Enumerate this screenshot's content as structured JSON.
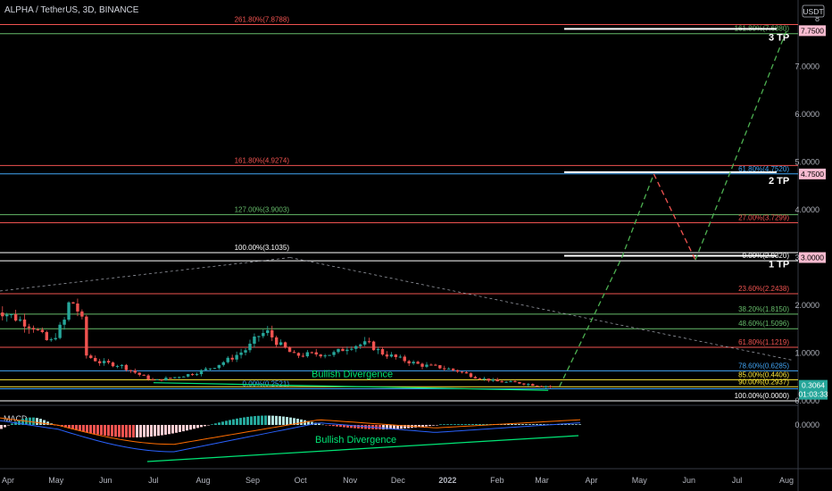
{
  "header": {
    "symbol_title": "ALPHA / TetherUS, 3D, BINANCE",
    "currency": "USDT"
  },
  "colors": {
    "up": "#26a69a",
    "down": "#ef5350",
    "fib_red": "#ef5350",
    "fib_green": "#66bb6a",
    "fib_blue": "#42a5f5",
    "fib_white": "#ffffff",
    "fib_yellow": "#ffeb3b",
    "projection": "#4caf50",
    "projection_down": "#ef5350",
    "divergence": "#00e676",
    "macd_line": "#2962ff",
    "signal_line": "#ff6d00"
  },
  "chart_data": {
    "type": "candlestick",
    "ylim": [
      0,
      8
    ],
    "y_ticks": [
      "0.0000",
      "1.0000",
      "2.0000",
      "3.0000",
      "4.0000",
      "5.0000",
      "6.0000",
      "7.0000",
      "8"
    ],
    "x_ticks": [
      {
        "label": "Apr",
        "date": "2021-04-01"
      },
      {
        "label": "May",
        "date": "2021-05-01"
      },
      {
        "label": "Jun",
        "date": "2021-06-01"
      },
      {
        "label": "Jul",
        "date": "2021-07-01"
      },
      {
        "label": "Aug",
        "date": "2021-08-01"
      },
      {
        "label": "Sep",
        "date": "2021-09-01"
      },
      {
        "label": "Oct",
        "date": "2021-10-01"
      },
      {
        "label": "Nov",
        "date": "2021-11-01"
      },
      {
        "label": "Dec",
        "date": "2021-12-01"
      },
      {
        "label": "2022",
        "date": "2022-01-01"
      },
      {
        "label": "Feb",
        "date": "2022-02-01"
      },
      {
        "label": "Mar",
        "date": "2022-03-01"
      },
      {
        "label": "Apr",
        "date": "2022-04-01"
      },
      {
        "label": "May",
        "date": "2022-05-01"
      },
      {
        "label": "Jun",
        "date": "2022-06-01"
      },
      {
        "label": "Jul",
        "date": "2022-07-01"
      },
      {
        "label": "Aug",
        "date": "2022-08-01"
      }
    ],
    "price_path": [
      {
        "date": "2021-03-23",
        "close": 1.95
      },
      {
        "date": "2021-04-05",
        "close": 1.75
      },
      {
        "date": "2021-04-17",
        "close": 1.55
      },
      {
        "date": "2021-04-27",
        "close": 1.2
      },
      {
        "date": "2021-05-06",
        "close": 1.65
      },
      {
        "date": "2021-05-10",
        "close": 2.15
      },
      {
        "date": "2021-05-17",
        "close": 1.75
      },
      {
        "date": "2021-05-20",
        "close": 0.95
      },
      {
        "date": "2021-05-29",
        "close": 0.8
      },
      {
        "date": "2021-06-10",
        "close": 0.75
      },
      {
        "date": "2021-06-22",
        "close": 0.55
      },
      {
        "date": "2021-07-01",
        "close": 0.42
      },
      {
        "date": "2021-07-15",
        "close": 0.5
      },
      {
        "date": "2021-07-27",
        "close": 0.58
      },
      {
        "date": "2021-08-08",
        "close": 0.72
      },
      {
        "date": "2021-08-19",
        "close": 0.9
      },
      {
        "date": "2021-08-29",
        "close": 1.1
      },
      {
        "date": "2021-09-04",
        "close": 1.35
      },
      {
        "date": "2021-09-10",
        "close": 1.45
      },
      {
        "date": "2021-09-17",
        "close": 1.2
      },
      {
        "date": "2021-09-27",
        "close": 0.95
      },
      {
        "date": "2021-10-09",
        "close": 0.98
      },
      {
        "date": "2021-10-21",
        "close": 0.98
      },
      {
        "date": "2021-11-01",
        "close": 1.15
      },
      {
        "date": "2021-11-12",
        "close": 1.2
      },
      {
        "date": "2021-11-21",
        "close": 1.0
      },
      {
        "date": "2021-12-02",
        "close": 0.88
      },
      {
        "date": "2021-12-15",
        "close": 0.75
      },
      {
        "date": "2021-12-28",
        "close": 0.7
      },
      {
        "date": "2022-01-08",
        "close": 0.62
      },
      {
        "date": "2022-01-20",
        "close": 0.48
      },
      {
        "date": "2022-02-02",
        "close": 0.4
      },
      {
        "date": "2022-02-14",
        "close": 0.38
      },
      {
        "date": "2022-02-27",
        "close": 0.32
      },
      {
        "date": "2022-03-08",
        "close": 0.3
      }
    ],
    "fib_levels_left": [
      {
        "label": "261.80%(7.8788)",
        "value": 7.8788,
        "color": "fib_red"
      },
      {
        "label": "161.80%(4.9274)",
        "value": 4.9274,
        "color": "fib_red"
      },
      {
        "label": "127.00%(3.9003)",
        "value": 3.9003,
        "color": "fib_green"
      },
      {
        "label": "100.00%(3.1035)",
        "value": 3.1035,
        "color": "fib_white"
      },
      {
        "label": "0.00%(0.2521)",
        "value": 0.2521,
        "color": "fib_blue"
      }
    ],
    "fib_levels_right": [
      {
        "label": "161.80%(7.6880)",
        "value": 7.688,
        "color": "fib_green"
      },
      {
        "label": "61.80%(4.7520)",
        "value": 4.752,
        "color": "fib_blue"
      },
      {
        "label": "27.00%(3.7299)",
        "value": 3.7299,
        "color": "fib_red"
      },
      {
        "label": "0.00%(2.9320)",
        "value": 2.932,
        "color": "fib_white"
      },
      {
        "label": "23.60%(2.2438)",
        "value": 2.2438,
        "color": "fib_red"
      },
      {
        "label": "38.20%(1.8150)",
        "value": 1.815,
        "color": "fib_green"
      },
      {
        "label": "48.60%(1.5096)",
        "value": 1.5096,
        "color": "fib_green"
      },
      {
        "label": "61.80%(1.1219)",
        "value": 1.1219,
        "color": "fib_red"
      },
      {
        "label": "78.60%(0.6285)",
        "value": 0.6285,
        "color": "fib_blue"
      },
      {
        "label": "85.00%(0.4406)",
        "value": 0.4406,
        "color": "fib_yellow"
      },
      {
        "label": "90.00%(0.2937)",
        "value": 0.2937,
        "color": "fib_yellow"
      },
      {
        "label": "100.00%(0.0000)",
        "value": 0.0,
        "color": "fib_white"
      }
    ],
    "targets": [
      {
        "label": "3 TP",
        "price": "7.7500",
        "value": 7.75
      },
      {
        "label": "2 TP",
        "price": "4.7500",
        "value": 4.75
      },
      {
        "label": "1 TP",
        "price": "3.0000",
        "value": 3.0
      }
    ],
    "projection": [
      {
        "date": "2022-03-12",
        "value": 0.3
      },
      {
        "date": "2022-04-20",
        "value": 3.0
      },
      {
        "date": "2022-05-10",
        "value": 4.75
      },
      {
        "date": "2022-06-05",
        "value": 2.95
      },
      {
        "date": "2022-08-01",
        "value": 7.75
      }
    ],
    "current_price": "0.3064",
    "countdown": "01:03:33",
    "annotations": [
      "Bullish Divergence",
      "Bullish Divergence"
    ],
    "macd": {
      "label": "MACD",
      "y_ticks": [
        "0.0000"
      ]
    }
  }
}
